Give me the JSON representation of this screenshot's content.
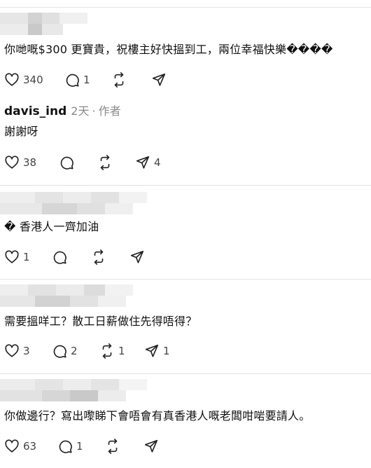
{
  "colors": {
    "text": "#111111",
    "muted": "#8a8a8a",
    "divider": "#e2e2e2",
    "icon": "#222222"
  },
  "comments": [
    {
      "text": "你哋嘅$300 更寶貴，祝樓主好快搵到工，兩位幸福快樂����",
      "likes": "340",
      "replies": "1",
      "reposts": "",
      "shares": ""
    },
    {
      "author": "davis_ind",
      "time": "2天",
      "role": "作者",
      "text": "謝謝呀",
      "likes": "38",
      "replies": "",
      "reposts": "",
      "shares": "4"
    },
    {
      "text": "� 香港人一齊加油",
      "likes": "1",
      "replies": "",
      "reposts": "",
      "shares": ""
    },
    {
      "text": "需要搵咩工？散工日薪做住先得唔得？",
      "likes": "3",
      "replies": "2",
      "reposts": "1",
      "shares": "1"
    },
    {
      "text": "你做邊行？寫出嚟睇下會唔會有真香港人嘅老闆咁啱要請人。",
      "likes": "63",
      "replies": "1",
      "reposts": "",
      "shares": ""
    }
  ],
  "icons": [
    "heart-icon",
    "comment-icon",
    "repost-icon",
    "send-icon"
  ]
}
